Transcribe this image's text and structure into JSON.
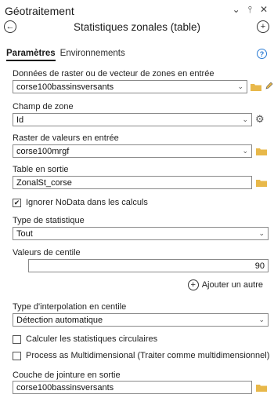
{
  "window": {
    "title": "Géotraitement",
    "controls": [
      "⌄",
      "⫯",
      "✕"
    ]
  },
  "tool": {
    "title": "Statistiques zonales (table)"
  },
  "tabs": {
    "params": "Paramètres",
    "env": "Environnements"
  },
  "fields": {
    "zone_data": {
      "label": "Données de raster ou de vecteur de zones en entrée",
      "value": "corse100bassinsversants"
    },
    "zone_field": {
      "label": "Champ de zone",
      "value": "Id"
    },
    "value_raster": {
      "label": "Raster de valeurs en entrée",
      "value": "corse100mrgf"
    },
    "out_table": {
      "label": "Table en sortie",
      "value": "ZonalSt_corse"
    },
    "ignore_nodata": {
      "label": "Ignorer NoData dans les calculs",
      "checked": true
    },
    "stat_type": {
      "label": "Type de statistique",
      "value": "Tout"
    },
    "percentile": {
      "label": "Valeurs de centile",
      "value": "90"
    },
    "add_other": "Ajouter un autre",
    "interp": {
      "label": "Type d'interpolation en centile",
      "value": "Détection automatique"
    },
    "circular": {
      "label": "Calculer les statistiques circulaires",
      "checked": false
    },
    "multidim": {
      "label": "Process as Multidimensional (Traiter comme multidimensionnel)",
      "checked": false
    },
    "join_layer": {
      "label": "Couche de jointure en sortie",
      "value": "corse100bassinsversants"
    }
  },
  "colors": {
    "folder": "#e8b84a",
    "accent": "#2a7bd4"
  }
}
